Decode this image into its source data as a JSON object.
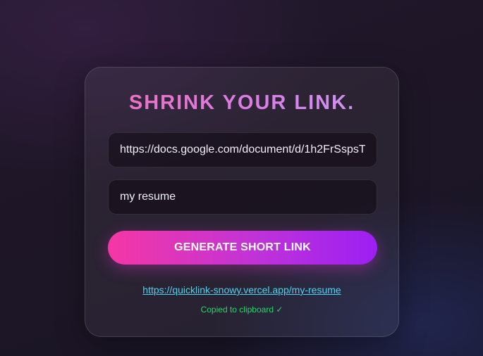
{
  "title": "SHRINK YOUR LINK.",
  "form": {
    "url_value": "https://docs.google.com/document/d/1h2FrSspsT",
    "alias_value": "my resume",
    "submit_label": "GENERATE SHORT LINK"
  },
  "result": {
    "short_link": "https://quicklink-snowy.vercel.app/my-resume",
    "status_text": "Copied to clipboard",
    "status_icon": "✓"
  },
  "colors": {
    "button_gradient_start": "#f537a4",
    "button_gradient_end": "#9c1ff3",
    "link": "#4fd3ee",
    "success": "#2bd46b"
  }
}
